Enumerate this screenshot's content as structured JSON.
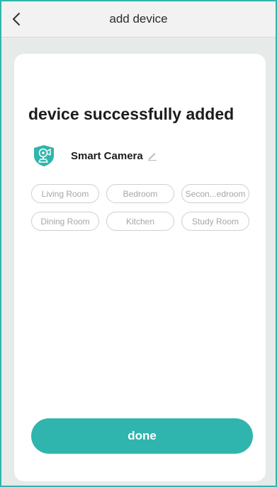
{
  "header": {
    "title": "add device",
    "back_icon": "chevron-left-icon"
  },
  "main": {
    "headline": "device successfully added",
    "device": {
      "icon": "camera-shield-icon",
      "name": "Smart  Camera",
      "edit_icon": "pencil-icon"
    },
    "rooms": [
      [
        "Living Room",
        "Bedroom",
        "Secon...edroom"
      ],
      [
        "Dining Room",
        "Kitchen",
        "Study Room"
      ]
    ],
    "done_label": "done"
  },
  "colors": {
    "accent": "#2fb5ad",
    "background": "#e6ebea",
    "chip_text": "#a6a6a6"
  }
}
